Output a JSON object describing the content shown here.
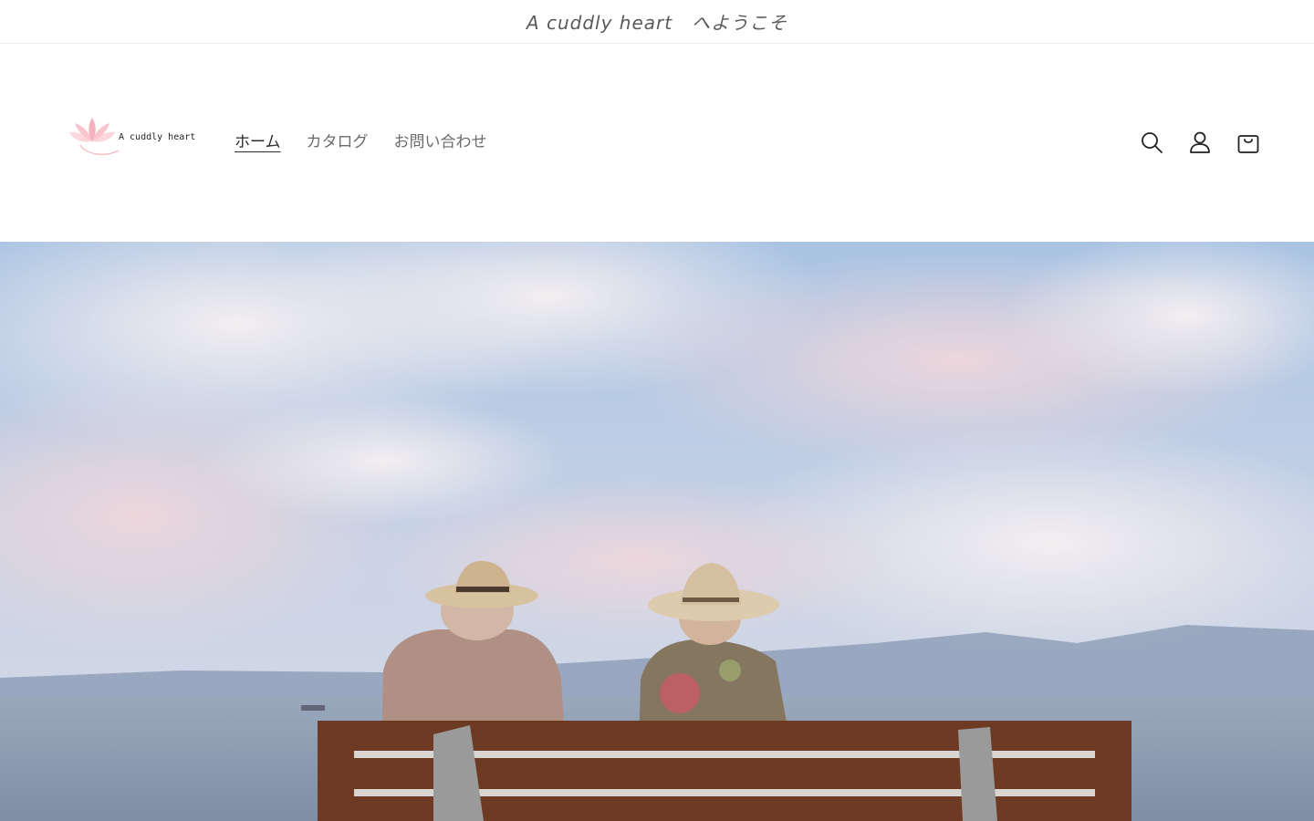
{
  "announcement": {
    "text": "A cuddly heart　へようこそ"
  },
  "header": {
    "logo_text": "A cuddly heart",
    "nav": [
      {
        "label": "ホーム",
        "active": true
      },
      {
        "label": "カタログ",
        "active": false
      },
      {
        "label": "お問い合わせ",
        "active": false
      }
    ],
    "icons": [
      "search-icon",
      "account-icon",
      "cart-icon"
    ]
  },
  "hero": {
    "image": "elderly couple on bench facing sea under cloudy sky"
  },
  "colors": {
    "accent_pink": "#f2a7b3",
    "text_muted": "#6b6b6b",
    "bench_brown": "#6e3a24",
    "sky_blue": "#8fb3d9"
  }
}
